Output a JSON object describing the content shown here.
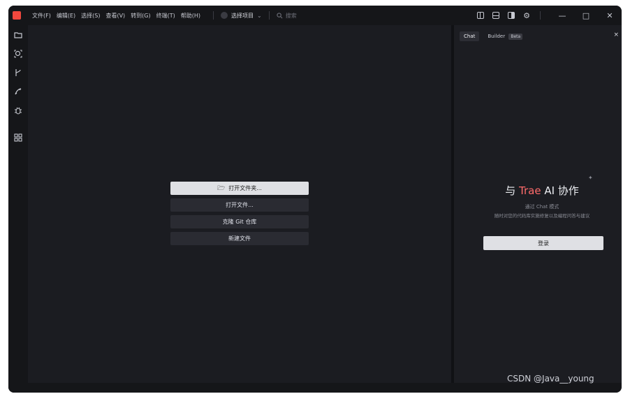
{
  "menu": [
    "文件(F)",
    "编辑(E)",
    "选择(S)",
    "查看(V)",
    "转到(G)",
    "终端(T)",
    "帮助(H)"
  ],
  "project": {
    "label": "选择项目",
    "chevron": "⌄"
  },
  "search": {
    "icon": "search-icon",
    "placeholder": "搜索"
  },
  "window_controls": {
    "minimize": "—",
    "maximize": "□",
    "close": "✕"
  },
  "activity_icons": [
    "folder-icon",
    "search-icon",
    "source-control-icon",
    "debug-icon",
    "bug-icon",
    "extensions-icon"
  ],
  "welcome": {
    "open_folder": "打开文件夹...",
    "open_file": "打开文件...",
    "clone_repo": "克隆 Git 仓库",
    "new_file": "新建文件"
  },
  "panel": {
    "tabs": [
      "Chat",
      "Builder"
    ],
    "beta": "Beta",
    "close": "×",
    "title_prefix": "与 ",
    "title_brand": "Trae",
    "title_suffix": " AI 协作",
    "subtitle1": "通过 Chat 模式",
    "subtitle2": "随时对您的代码库实施修复以及编程问答与建议",
    "login": "登录"
  },
  "watermark": "CSDN @Java__young",
  "colors": {
    "accent": "#f0483e",
    "brand_text": "#ff6b6b",
    "bg": "#1b1c21"
  }
}
